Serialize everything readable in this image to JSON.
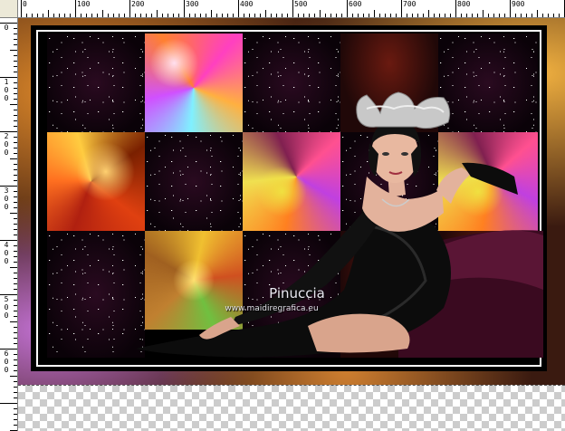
{
  "ruler": {
    "top_labels": [
      "0",
      "100",
      "200",
      "300",
      "400",
      "500",
      "600",
      "700",
      "800",
      "900"
    ],
    "left_labels": [
      "0",
      "100",
      "200",
      "300",
      "400",
      "500",
      "600"
    ]
  },
  "watermark": {
    "name": "Pinuccia",
    "url": "www.maidiregrafica.eu"
  },
  "colors": {
    "frame_border": "#ffffff",
    "frame_background": "#000000",
    "checker_light": "#ffffff",
    "checker_dark": "#cccccc"
  }
}
